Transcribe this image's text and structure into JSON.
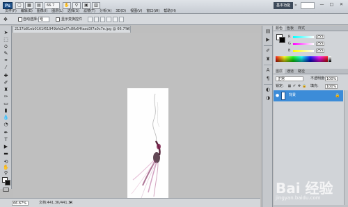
{
  "app": {
    "logo": "Ps",
    "zoom_top": "66.7",
    "workspace": "基本功能",
    "workspace_more": "»",
    "window_controls": [
      "—",
      "□",
      "✕"
    ]
  },
  "menu": {
    "items": [
      "文件(F)",
      "编辑(E)",
      "图像(I)",
      "图层(L)",
      "选择(S)",
      "滤镜(T)",
      "分析(A)",
      "3D(D)",
      "视图(V)",
      "窗口(W)",
      "帮助(H)"
    ]
  },
  "options": {
    "auto_select_label": "自动选择:",
    "auto_select_value": "组",
    "transform_label": "显示变换控件"
  },
  "document": {
    "tab_title": "2137b81eb0161f61949bfd2ef7c8fb64faad3f7a0c7e.jpg @ 66.7%(RGB/8) *",
    "tab_close": "×",
    "zoom_status": "66.67%",
    "doc_size": "文档:441.3K/441.3K",
    "status_arrow": "▸"
  },
  "panels": {
    "color_tabs": [
      "颜色",
      "色板",
      "样式"
    ],
    "sliders": [
      {
        "label": "R",
        "value": "255",
        "gradient": [
          "#00ffff",
          "#ffffff"
        ]
      },
      {
        "label": "G",
        "value": "255",
        "gradient": [
          "#ff00ff",
          "#ffffff"
        ]
      },
      {
        "label": "B",
        "value": "255",
        "gradient": [
          "#ffff00",
          "#ffffff"
        ]
      }
    ],
    "layers_tabs": [
      "图层",
      "通道",
      "路径"
    ],
    "blend_mode": "正常",
    "opacity_label": "不透明度:",
    "opacity_value": "100%",
    "lock_label": "锁定:",
    "fill_label": "填充:",
    "fill_value": "100%",
    "layer_name": "背景",
    "layer_eye": "●",
    "layer_lock": "🔒"
  },
  "watermark": {
    "text": "Bai 经验",
    "url": "jingyan.baidu.com"
  },
  "colors": {
    "layer_selected": "#3c8cd8",
    "workspace_bg": "#bfbfbf",
    "chrome": "#d6d9dd"
  }
}
